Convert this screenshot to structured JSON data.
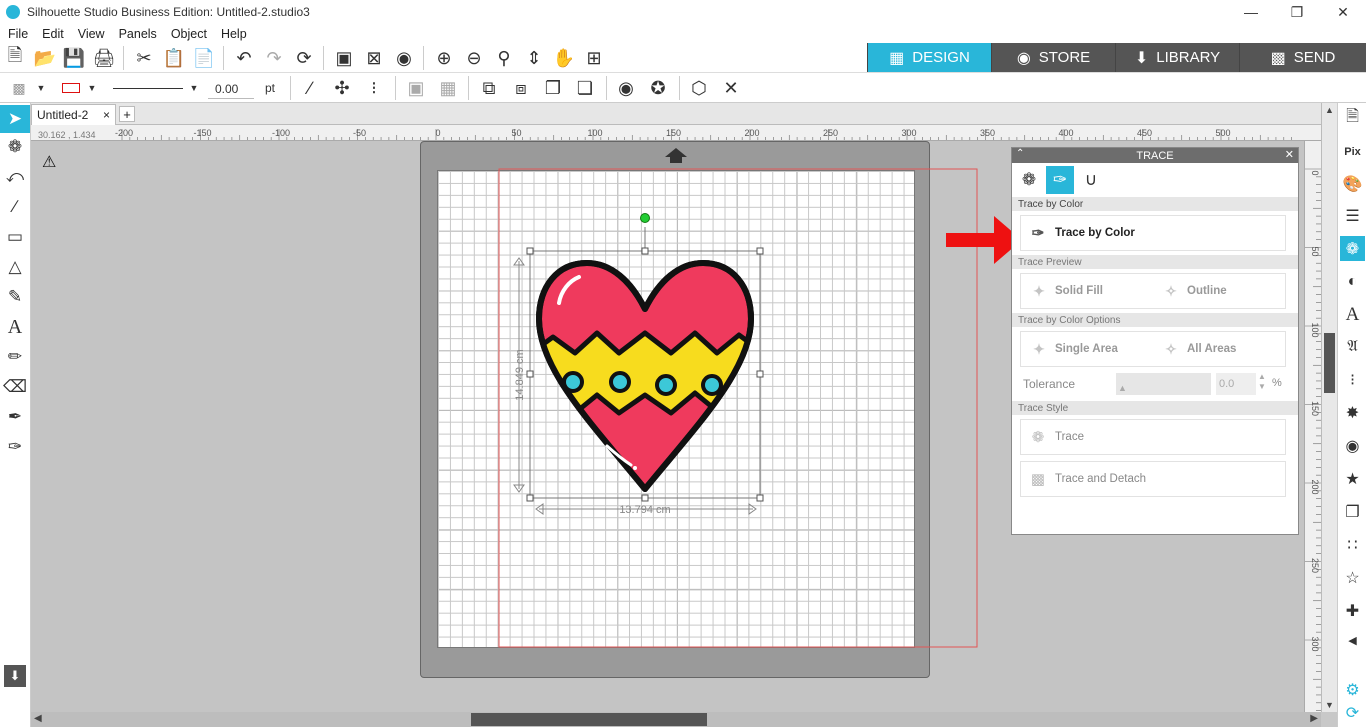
{
  "titlebar": {
    "title": "Silhouette Studio Business Edition: Untitled-2.studio3"
  },
  "menu": {
    "items": [
      "File",
      "Edit",
      "View",
      "Panels",
      "Object",
      "Help"
    ]
  },
  "modes": [
    {
      "label": "DESIGN",
      "icon": "grid-icon"
    },
    {
      "label": "STORE",
      "icon": "store-icon"
    },
    {
      "label": "LIBRARY",
      "icon": "library-icon"
    },
    {
      "label": "SEND",
      "icon": "send-icon"
    }
  ],
  "line_style": {
    "width_value": "0.00",
    "unit": "pt"
  },
  "document": {
    "tab_name": "Untitled-2",
    "tab_close": "×",
    "add_tab": "+"
  },
  "coordinate_readout": "30.162 , 1.434",
  "ruler": {
    "h_labels": [
      "-200",
      "-150",
      "-100",
      "-50",
      "0",
      "50",
      "100",
      "150",
      "200",
      "250",
      "300",
      "350",
      "400",
      "450",
      "500"
    ],
    "v_labels": [
      "0",
      "50",
      "100",
      "150",
      "200",
      "250",
      "300"
    ]
  },
  "selection": {
    "height_label": "14.849 cm",
    "width_label": "13.794 cm"
  },
  "trace_panel": {
    "title": "TRACE",
    "sections": {
      "by_color": "Trace by Color",
      "preview": "Trace Preview",
      "options": "Trace by Color Options",
      "style": "Trace Style"
    },
    "buttons": {
      "trace_by_color": "Trace by Color",
      "solid_fill": "Solid Fill",
      "outline": "Outline",
      "single_area": "Single Area",
      "all_areas": "All Areas",
      "trace": "Trace",
      "trace_and_detach": "Trace and Detach"
    },
    "tolerance": {
      "label": "Tolerance",
      "value": "0.0",
      "unit": "%"
    }
  },
  "colors": {
    "accent": "#29b6d9",
    "heart_red": "#ef3a5d",
    "heart_yellow": "#f7dc1e",
    "dot_cyan": "#3cc8d8",
    "arrow_red": "#ee1111"
  }
}
